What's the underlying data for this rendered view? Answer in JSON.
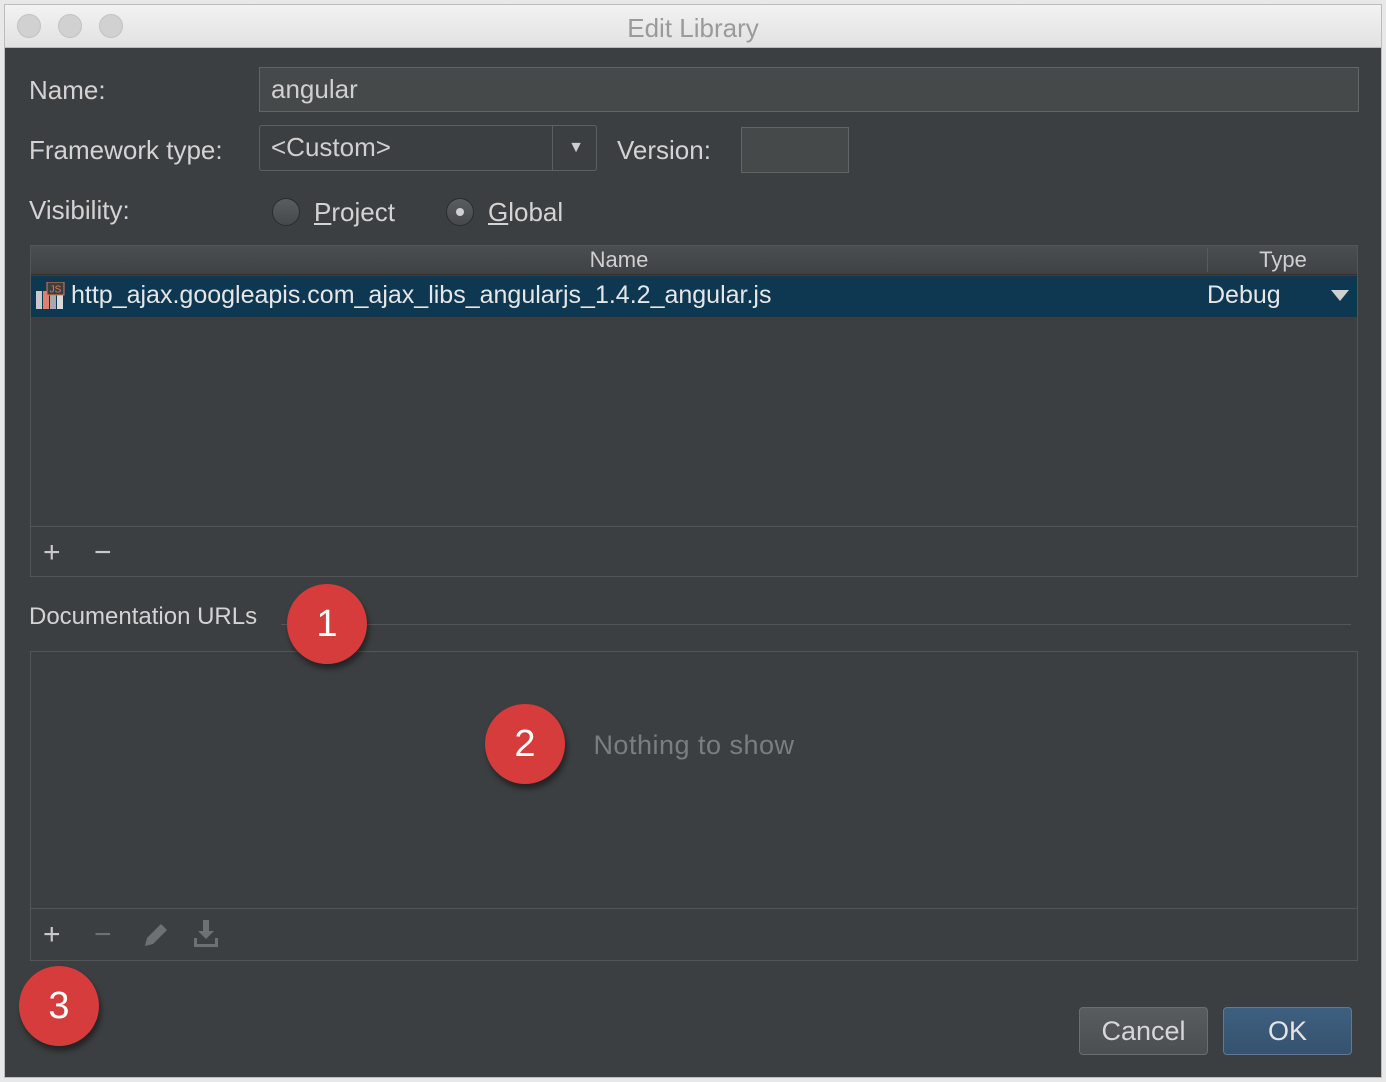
{
  "window": {
    "title": "Edit Library"
  },
  "form": {
    "name_label": "Name:",
    "name_value": "angular",
    "framework_label": "Framework type:",
    "framework_value": "<Custom>",
    "version_label": "Version:",
    "version_value": "",
    "visibility_label": "Visibility:",
    "visibility_options": [
      {
        "label_first": "P",
        "label_rest": "roject",
        "selected": false
      },
      {
        "label_first": "G",
        "label_rest": "lobal",
        "selected": true
      }
    ]
  },
  "files_table": {
    "columns": [
      "Name",
      "Type"
    ],
    "rows": [
      {
        "name": "http_ajax.googleapis.com_ajax_libs_angularjs_1.4.2_angular.js",
        "type": "Debug",
        "icon": "js-file-icon",
        "icon_text": "JS"
      }
    ],
    "toolbar": {
      "add": "+",
      "remove": "−"
    }
  },
  "docs": {
    "section_title": "Documentation URLs",
    "empty_text": "Nothing to show",
    "toolbar": {
      "add": "+",
      "remove": "−"
    }
  },
  "buttons": {
    "cancel": "Cancel",
    "ok": "OK"
  },
  "callouts": [
    "1",
    "2",
    "3"
  ],
  "colors": {
    "selection": "#0e3752",
    "badge": "#d63c3b",
    "background": "#3c3f41"
  }
}
